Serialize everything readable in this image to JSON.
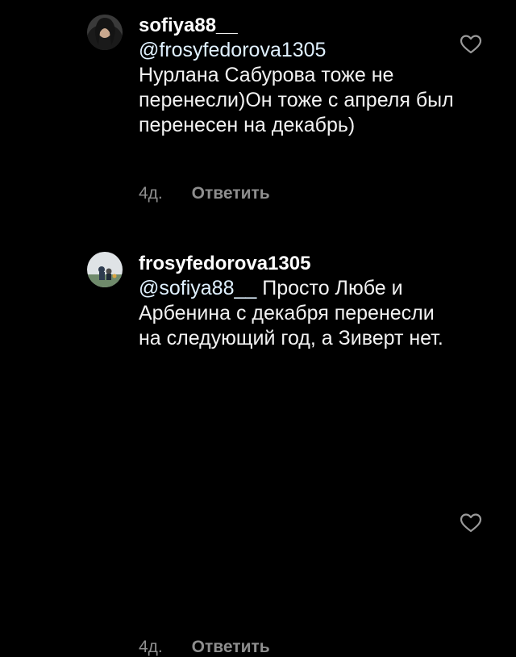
{
  "comments": [
    {
      "username": "sofiya88__",
      "mention": "@frosyfedorova1305",
      "text": "Нурлана Сабурова тоже не перенесли)Он тоже с апреля был перенесен на декабрь)",
      "time": "4д.",
      "reply_label": "Ответить",
      "avatar_icon": "user-avatar-photo",
      "like_icon": "heart-outline-icon"
    },
    {
      "username": "frosyfedorova1305",
      "mention": "@sofiya88__",
      "text": "Просто Любе и Арбенина с декабря перенесли на следующий год, а Зиверт нет.",
      "time": "4д.",
      "reply_label": "Ответить",
      "avatar_icon": "user-avatar-photo",
      "like_icon": "heart-outline-icon"
    }
  ],
  "colors": {
    "background": "#000000",
    "text": "#ffffff",
    "secondary": "#8e8e8e",
    "mention": "#e0f1ff"
  }
}
